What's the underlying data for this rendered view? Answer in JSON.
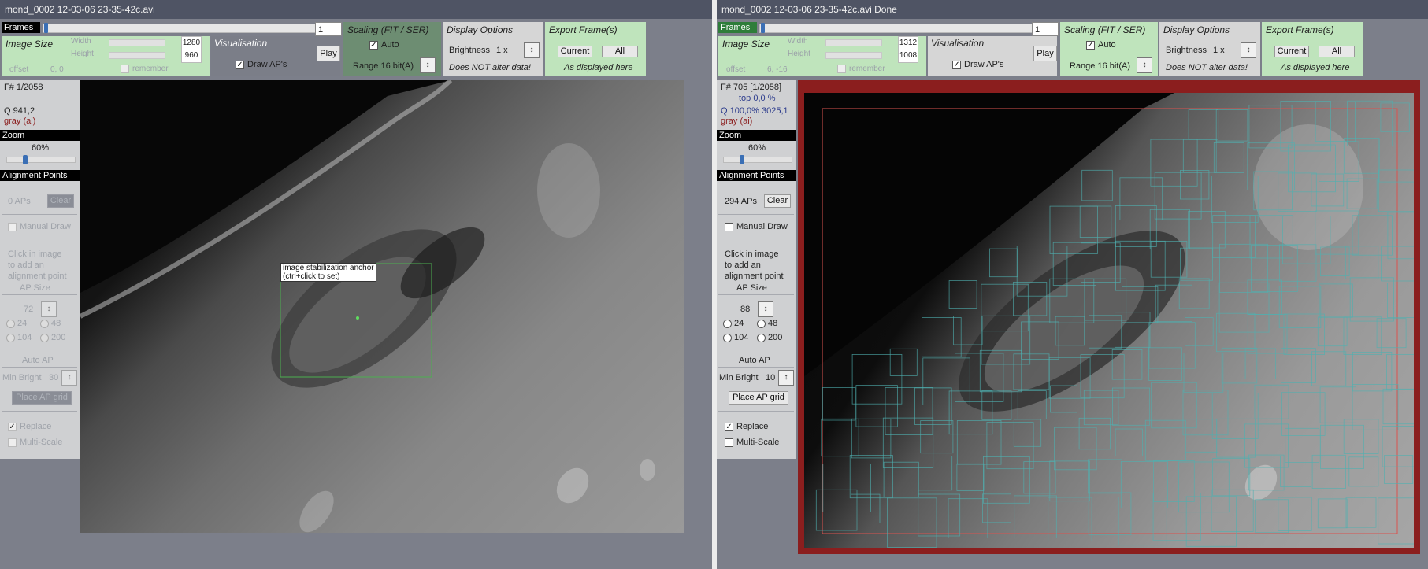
{
  "colors": {
    "panel_green": "#bfe4bc",
    "scaling_green": "#6d8d72",
    "border_red": "#8b1e1e",
    "ap_cyan": "#4fb0b0",
    "title_bar": "#4f5464"
  },
  "left": {
    "title": "mond_0002 12-03-06 23-35-42c.avi",
    "frames_label": "Frames",
    "frame_value": "1",
    "frame_progress": 0.003,
    "image_size": {
      "title": "Image Size",
      "width_label": "Width",
      "height_label": "Height",
      "width": "1280",
      "height": "960",
      "offset_label": "offset",
      "offset": "0, 0",
      "remember": "remember"
    },
    "visualisation": {
      "title": "Visualisation",
      "draw_aps": "Draw AP's",
      "play": "Play"
    },
    "scaling": {
      "title": "Scaling (FIT / SER)",
      "auto": "Auto",
      "range": "Range 16 bit(A)"
    },
    "display": {
      "title": "Display Options",
      "brightness": "Brightness",
      "brightness_val": "1 x",
      "note": "Does NOT alter data!"
    },
    "export": {
      "title": "Export Frame(s)",
      "current": "Current",
      "all": "All",
      "note": "As displayed here"
    },
    "info": {
      "frame": "F# 1/2058",
      "q": "Q  941,2",
      "gray": "gray (ai)"
    },
    "zoom": {
      "label": "Zoom",
      "value": "60%",
      "level": 0.25
    },
    "ap": {
      "label": "Alignment Points",
      "count": "0 APs",
      "clear": "Clear",
      "manual_draw": "Manual Draw",
      "hint1": "Click in image",
      "hint2": "to add an",
      "hint3": "alignment point",
      "size_label": "AP Size",
      "size": "72",
      "r24": "24",
      "r48": "48",
      "r104": "104",
      "r200": "200",
      "auto_ap": "Auto AP",
      "min_bright": "Min Bright",
      "min_bright_val": "30",
      "place_grid": "Place AP grid",
      "replace": "Replace",
      "multiscale": "Multi-Scale"
    },
    "tooltip": {
      "line1": "image stabilization anchor",
      "line2": "(ctrl+click to set)"
    }
  },
  "right": {
    "title": "mond_0002 12-03-06 23-35-42c.avi   Done",
    "frames_label": "Frames",
    "frame_value": "1",
    "frame_progress": 0.003,
    "image_size": {
      "title": "Image Size",
      "width_label": "Width",
      "height_label": "Height",
      "width": "1312",
      "height": "1008",
      "offset_label": "offset",
      "offset": "6, -16",
      "remember": "remember"
    },
    "visualisation": {
      "title": "Visualisation",
      "draw_aps": "Draw AP's",
      "play": "Play"
    },
    "scaling": {
      "title": "Scaling (FIT / SER)",
      "auto": "Auto",
      "range": "Range 16 bit(A)"
    },
    "display": {
      "title": "Display Options",
      "brightness": "Brightness",
      "brightness_val": "1 x",
      "note": "Does NOT alter data!"
    },
    "export": {
      "title": "Export Frame(s)",
      "current": "Current",
      "all": "All",
      "note": "As displayed here"
    },
    "info": {
      "frame": "F# 705 [1/2058]",
      "top": "top 0,0 %",
      "q": "Q 100,0%  3025,1",
      "gray": "gray (ai)"
    },
    "zoom": {
      "label": "Zoom",
      "value": "60%",
      "level": 0.25
    },
    "ap": {
      "label": "Alignment Points",
      "count": "294 APs",
      "clear": "Clear",
      "manual_draw": "Manual Draw",
      "hint1": "Click in image",
      "hint2": "to add an",
      "hint3": "alignment point",
      "size_label": "AP Size",
      "size": "88",
      "r24": "24",
      "r48": "48",
      "r104": "104",
      "r200": "200",
      "auto_ap": "Auto AP",
      "min_bright": "Min Bright",
      "min_bright_val": "10",
      "place_grid": "Place AP grid",
      "replace": "Replace",
      "multiscale": "Multi-Scale"
    }
  }
}
